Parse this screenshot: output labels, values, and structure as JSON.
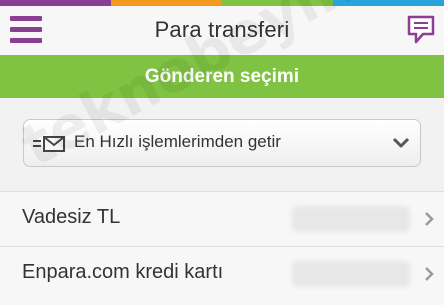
{
  "colors": {
    "rainbow": [
      "#8a3f93",
      "#f39a1f",
      "#80c342",
      "#29a3dc"
    ],
    "accent_purple": "#8a3f93",
    "accent_green": "#80c342"
  },
  "header": {
    "title": "Para transferi",
    "menu_icon": "hamburger-menu-icon",
    "chat_icon": "chat-bubble-icon"
  },
  "subheader": {
    "title": "Gönderen seçimi"
  },
  "selector": {
    "icon": "fast-transfer-envelope-icon",
    "label": "En Hızlı işlemlerimden getir",
    "chevron_icon": "chevron-down-icon"
  },
  "accounts": [
    {
      "label": "Vadesiz TL",
      "chevron_icon": "chevron-right-icon"
    },
    {
      "label": "Enpara.com kredi kartı",
      "chevron_icon": "chevron-right-icon"
    }
  ],
  "watermark": "teknobeyin.com"
}
